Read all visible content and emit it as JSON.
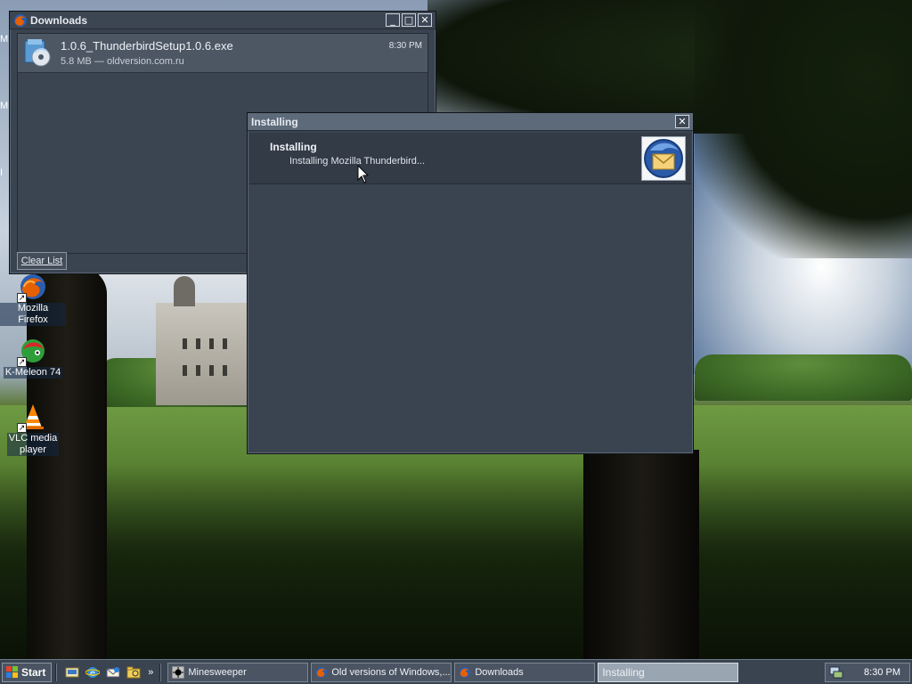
{
  "desktop": {
    "icons": [
      {
        "label": "Mozilla Firefox",
        "icon": "firefox-icon"
      },
      {
        "label": "K-Meleon 74",
        "icon": "kmeleon-icon"
      },
      {
        "label": "VLC media\nplayer",
        "icon": "vlc-icon"
      }
    ],
    "partial_left_letters": [
      "M",
      "M",
      "I"
    ]
  },
  "downloads_window": {
    "title": "Downloads",
    "items": [
      {
        "filename": "1.0.6_ThunderbirdSetup1.0.6.exe",
        "meta": "5.8 MB — oldversion.com.ru",
        "time": "8:30 PM",
        "icon": "installer-disc-icon"
      }
    ],
    "clear_list_label": "Clear List",
    "buttons": {
      "minimize": "_",
      "maximize": "□",
      "close": "✕"
    }
  },
  "installing_window": {
    "title": "Installing",
    "heading": "Installing",
    "status": "Installing Mozilla Thunderbird...",
    "logo": "thunderbird-icon",
    "close": "✕"
  },
  "taskbar": {
    "start_label": "Start",
    "quick_launch": [
      "show-desktop-icon",
      "ie-icon",
      "outlook-icon",
      "explorer-icon"
    ],
    "overflow": "»",
    "tasks": [
      {
        "label": "Minesweeper",
        "icon": "minesweeper-icon",
        "active": false
      },
      {
        "label": "Old versions of Windows,...",
        "icon": "firefox-icon",
        "active": false
      },
      {
        "label": "Downloads",
        "icon": "firefox-icon",
        "active": false
      },
      {
        "label": "Installing",
        "icon": "",
        "active": true
      }
    ],
    "clock": "8:30 PM",
    "tray_icon": "network-icon"
  },
  "colors": {
    "window_bg": "#3a4350",
    "titlebar": "#5e6b7a",
    "accent_firefox": "#e66000",
    "thunderbird_blue": "#2a5aa8"
  }
}
